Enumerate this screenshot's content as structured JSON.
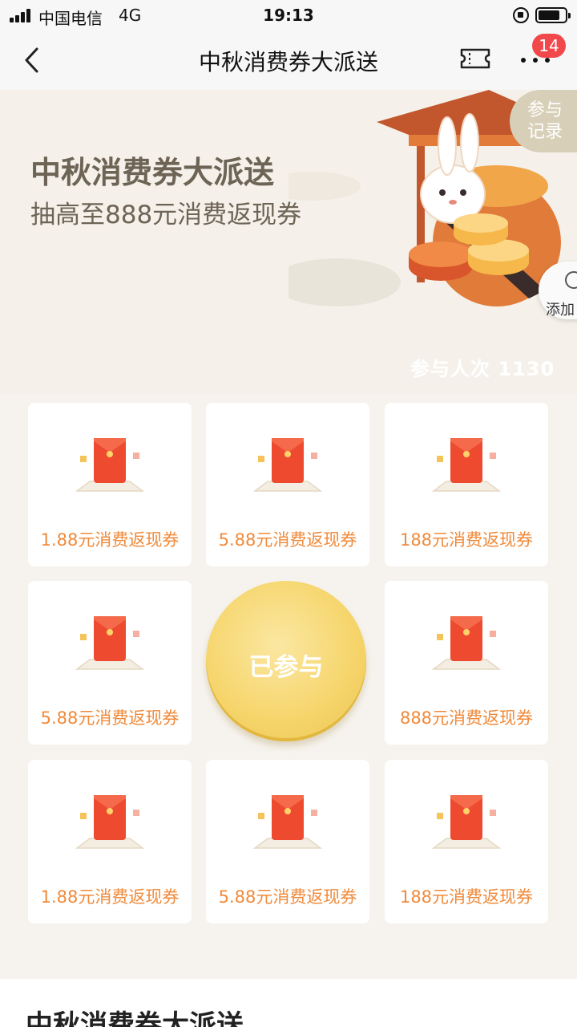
{
  "status_bar": {
    "carrier": "中国电信",
    "network": "4G",
    "time": "19:13"
  },
  "nav": {
    "title": "中秋消费券大派送",
    "badge_count": "14"
  },
  "hero": {
    "title": "中秋消费券大派送",
    "subtitle": "抽高至888元消费返现券",
    "record_label_line1": "参与",
    "record_label_line2": "记录",
    "add_label": "添加",
    "participants": "参与人次 1130"
  },
  "prizes": [
    {
      "label": "1.88元消费返现券"
    },
    {
      "label": "5.88元消费返现券"
    },
    {
      "label": "188元消费返现券"
    },
    {
      "label": "5.88元消费返现券"
    },
    {
      "label": "888元消费返现券"
    },
    {
      "label": "1.88元消费返现券"
    },
    {
      "label": "5.88元消费返现券"
    },
    {
      "label": "188元消费返现券"
    }
  ],
  "action": {
    "label": "已参与"
  },
  "bottom": {
    "title": "中秋消费券大派送"
  }
}
